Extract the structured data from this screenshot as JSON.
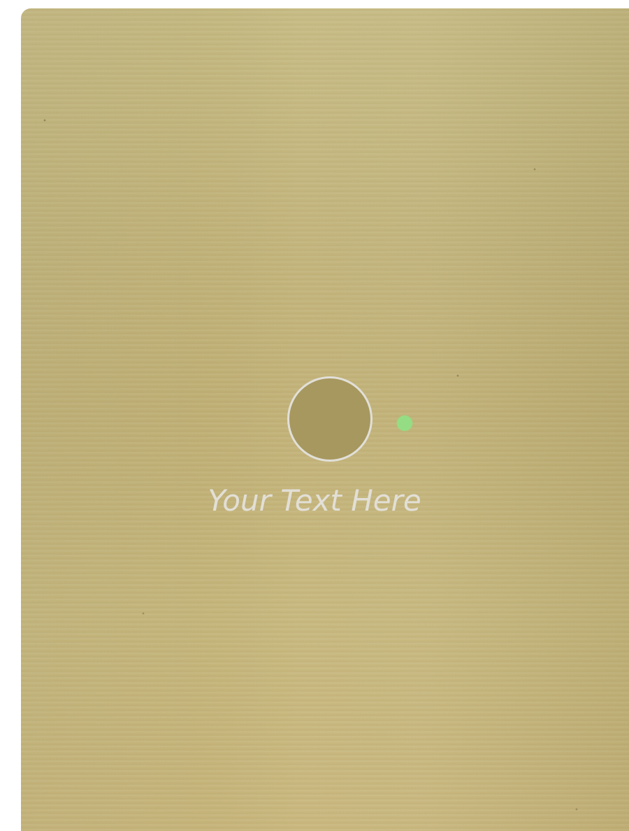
{
  "caption": {
    "text": "Your Text Here"
  },
  "colors": {
    "panel_base": "#c4b47a",
    "circle_fill": "#a7985f",
    "circle_border": "#e1dfd8",
    "status_dot": "#95dd84",
    "caption_text": "#e2dfd7"
  },
  "icons": {
    "status": "green-status-dot-icon"
  }
}
